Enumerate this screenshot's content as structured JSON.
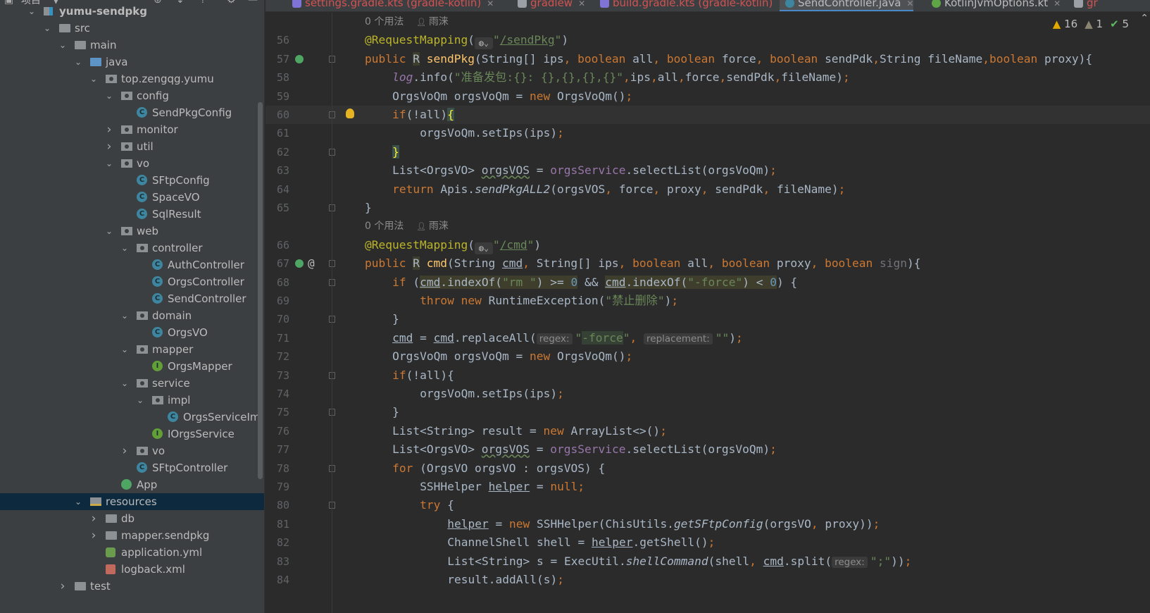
{
  "project_panel": {
    "title": "项目",
    "toolbar_icons": [
      "globe-target-icon",
      "expand-all-icon",
      "collapse-all-icon",
      "gear-icon",
      "minimize-icon"
    ],
    "tree": [
      {
        "label": "yumu-sendpkg",
        "level": 0,
        "icon": "module",
        "arrow": "open",
        "bold": true
      },
      {
        "label": "src",
        "level": 1,
        "icon": "folder",
        "arrow": "open"
      },
      {
        "label": "main",
        "level": 2,
        "icon": "folder",
        "arrow": "open"
      },
      {
        "label": "java",
        "level": 3,
        "icon": "folder-blue",
        "arrow": "open"
      },
      {
        "label": "top.zengqg.yumu",
        "level": 4,
        "icon": "package",
        "arrow": "open"
      },
      {
        "label": "config",
        "level": 5,
        "icon": "package",
        "arrow": "open"
      },
      {
        "label": "SendPkgConfig",
        "level": 6,
        "icon": "class"
      },
      {
        "label": "monitor",
        "level": 5,
        "icon": "package",
        "arrow": "closed"
      },
      {
        "label": "util",
        "level": 5,
        "icon": "package",
        "arrow": "closed"
      },
      {
        "label": "vo",
        "level": 5,
        "icon": "package",
        "arrow": "open"
      },
      {
        "label": "SFtpConfig",
        "level": 6,
        "icon": "class"
      },
      {
        "label": "SpaceVO",
        "level": 6,
        "icon": "class"
      },
      {
        "label": "SqlResult",
        "level": 6,
        "icon": "class"
      },
      {
        "label": "web",
        "level": 5,
        "icon": "package",
        "arrow": "open"
      },
      {
        "label": "controller",
        "level": 6,
        "icon": "package",
        "arrow": "open"
      },
      {
        "label": "AuthController",
        "level": 7,
        "icon": "class"
      },
      {
        "label": "OrgsController",
        "level": 7,
        "icon": "class"
      },
      {
        "label": "SendController",
        "level": 7,
        "icon": "class"
      },
      {
        "label": "domain",
        "level": 6,
        "icon": "package",
        "arrow": "open"
      },
      {
        "label": "OrgsVO",
        "level": 7,
        "icon": "class"
      },
      {
        "label": "mapper",
        "level": 6,
        "icon": "package",
        "arrow": "open"
      },
      {
        "label": "OrgsMapper",
        "level": 7,
        "icon": "interface"
      },
      {
        "label": "service",
        "level": 6,
        "icon": "package",
        "arrow": "open"
      },
      {
        "label": "impl",
        "level": 7,
        "icon": "package",
        "arrow": "open"
      },
      {
        "label": "OrgsServiceIm|",
        "level": 8,
        "icon": "class"
      },
      {
        "label": "IOrgsService",
        "level": 7,
        "icon": "interface"
      },
      {
        "label": "vo",
        "level": 6,
        "icon": "package",
        "arrow": "closed"
      },
      {
        "label": "SFtpController",
        "level": 6,
        "icon": "class"
      },
      {
        "label": "App",
        "level": 5,
        "icon": "app"
      },
      {
        "label": "resources",
        "level": 3,
        "icon": "resources",
        "arrow": "open",
        "selected": true
      },
      {
        "label": "db",
        "level": 4,
        "icon": "folder",
        "arrow": "closed"
      },
      {
        "label": "mapper.sendpkg",
        "level": 4,
        "icon": "folder",
        "arrow": "closed"
      },
      {
        "label": "application.yml",
        "level": 4,
        "icon": "yml"
      },
      {
        "label": "logback.xml",
        "level": 4,
        "icon": "xml"
      },
      {
        "label": "test",
        "level": 2,
        "icon": "folder",
        "arrow": "closed"
      }
    ]
  },
  "tabs": [
    {
      "label": "settings.gradle.kts (gradle-kotlin)",
      "icon": "gradle",
      "error": true
    },
    {
      "label": "gradlew",
      "icon": "file",
      "error": true
    },
    {
      "label": "build.gradle.kts (gradle-kotlin)",
      "icon": "gradle",
      "error": true
    },
    {
      "label": "SendController.java",
      "icon": "java",
      "active": true
    },
    {
      "label": "KotlinJvmOptions.kt",
      "icon": "kt"
    },
    {
      "label": "gr",
      "icon": "file",
      "error": true
    }
  ],
  "inspections": {
    "warnings": "16",
    "weak_warnings": "1",
    "typos": "5"
  },
  "colors": {
    "accent": "#4a88c7",
    "keyword": "#cc7832",
    "string": "#6a8759",
    "annotation": "#bbb529",
    "method": "#ffc66d",
    "number": "#6897bb",
    "field": "#9876aa",
    "text": "#a9b7c6",
    "selection": "#0d293e"
  },
  "editor": {
    "rows": [
      {
        "inlay": {
          "usages": "0 个用法",
          "author": "雨涞"
        }
      },
      {
        "ln": "56",
        "t": [
          [
            "ann",
            "@RequestMapping"
          ],
          [
            "",
            "("
          ],
          [
            "globe",
            ""
          ],
          [
            "str",
            "\""
          ],
          [
            "str link",
            "/sendPkg"
          ],
          [
            "str",
            "\""
          ],
          [
            "",
            ")"
          ]
        ]
      },
      {
        "ln": "57",
        "g": "web",
        "fold": true,
        "t": [
          [
            "kw",
            "public "
          ],
          [
            "hl",
            "R"
          ],
          [
            "",
            " "
          ],
          [
            "fn",
            "sendPkg"
          ],
          [
            "",
            "(String[] ips"
          ],
          [
            "kw",
            ", boolean "
          ],
          [
            "",
            "all"
          ],
          [
            "kw",
            ", boolean "
          ],
          [
            "",
            "force"
          ],
          [
            "kw",
            ", boolean "
          ],
          [
            "",
            "sendPdk"
          ],
          [
            "kw",
            ","
          ],
          [
            "",
            "String fileName"
          ],
          [
            "kw",
            ",boolean "
          ],
          [
            "",
            "proxy){"
          ]
        ]
      },
      {
        "ln": "58",
        "i": 1,
        "t": [
          [
            "fldi",
            "log"
          ],
          [
            "",
            ".info("
          ],
          [
            "str",
            "\"准备发包:{}: {},{},{},{}\""
          ],
          [
            "kw",
            ","
          ],
          [
            "",
            "ips"
          ],
          [
            "kw",
            ","
          ],
          [
            "",
            "all"
          ],
          [
            "kw",
            ","
          ],
          [
            "",
            "force"
          ],
          [
            "kw",
            ","
          ],
          [
            "",
            "sendPdk"
          ],
          [
            "kw",
            ","
          ],
          [
            "",
            "fileName)"
          ],
          [
            "kw",
            ";"
          ]
        ]
      },
      {
        "ln": "59",
        "i": 1,
        "t": [
          [
            "",
            "OrgsVoQm orgsVoQm = "
          ],
          [
            "kw",
            "new "
          ],
          [
            "",
            "OrgsVoQm()"
          ],
          [
            "kw",
            ";"
          ]
        ]
      },
      {
        "ln": "60",
        "i": 1,
        "cur": true,
        "fold": true,
        "bulb": true,
        "t": [
          [
            "kw",
            "if"
          ],
          [
            "",
            "(!all)"
          ],
          [
            "brace",
            "{"
          ]
        ]
      },
      {
        "ln": "61",
        "i": 2,
        "t": [
          [
            "",
            "orgsVoQm.setIps(ips)"
          ],
          [
            "kw",
            ";"
          ]
        ]
      },
      {
        "ln": "62",
        "i": 1,
        "fold": true,
        "t": [
          [
            "brace",
            "}"
          ]
        ]
      },
      {
        "ln": "63",
        "i": 1,
        "t": [
          [
            "",
            "List<OrgsVO> "
          ],
          [
            "wavy",
            "orgsVOS"
          ],
          [
            "",
            " = "
          ],
          [
            "fld",
            "orgsService"
          ],
          [
            "",
            ".selectList(orgsVoQm)"
          ],
          [
            "kw",
            ";"
          ]
        ]
      },
      {
        "ln": "64",
        "i": 1,
        "t": [
          [
            "kw",
            "return "
          ],
          [
            "",
            "Apis."
          ],
          [
            "it",
            "sendPkgALL2"
          ],
          [
            "",
            "(orgsVOS"
          ],
          [
            "kw",
            ", "
          ],
          [
            "",
            "force"
          ],
          [
            "kw",
            ", "
          ],
          [
            "",
            "proxy"
          ],
          [
            "kw",
            ", "
          ],
          [
            "",
            "sendPdk"
          ],
          [
            "kw",
            ", "
          ],
          [
            "",
            "fileName)"
          ],
          [
            "kw",
            ";"
          ]
        ]
      },
      {
        "ln": "65",
        "fold": true,
        "t": [
          [
            "",
            "}"
          ]
        ]
      },
      {
        "inlay": {
          "usages": "0 个用法",
          "author": "雨涞"
        }
      },
      {
        "ln": "66",
        "t": [
          [
            "ann",
            "@RequestMapping"
          ],
          [
            "",
            "("
          ],
          [
            "globe",
            ""
          ],
          [
            "str",
            "\""
          ],
          [
            "str link",
            "/cmd"
          ],
          [
            "str",
            "\""
          ],
          [
            "",
            ")"
          ]
        ]
      },
      {
        "ln": "67",
        "g": "web",
        "at": true,
        "fold": true,
        "t": [
          [
            "kw",
            "public "
          ],
          [
            "hl",
            "R"
          ],
          [
            "",
            " "
          ],
          [
            "fn",
            "cmd"
          ],
          [
            "",
            "(String "
          ],
          [
            "ul",
            "cmd"
          ],
          [
            "kw",
            ", "
          ],
          [
            "",
            "String[] ips"
          ],
          [
            "kw",
            ", boolean "
          ],
          [
            "",
            "all"
          ],
          [
            "kw",
            ", boolean "
          ],
          [
            "",
            "proxy"
          ],
          [
            "kw",
            ", boolean "
          ],
          [
            "unused",
            "sign"
          ],
          [
            "",
            "){"
          ]
        ]
      },
      {
        "ln": "68",
        "i": 1,
        "fold": true,
        "t": [
          [
            "kw",
            "if "
          ],
          [
            "",
            "("
          ],
          [
            "ul hl",
            "cmd"
          ],
          [
            "hl",
            ".indexOf("
          ],
          [
            "str hl",
            "\"rm \""
          ],
          [
            "hl",
            ") >= "
          ],
          [
            "num hl",
            "0"
          ],
          [
            "",
            " && "
          ],
          [
            "ul hl",
            "cmd"
          ],
          [
            "hl",
            ".indexOf("
          ],
          [
            "str hl",
            "\"-force\""
          ],
          [
            "hl",
            ") < "
          ],
          [
            "num hl",
            "0"
          ],
          [
            "",
            ") {"
          ]
        ]
      },
      {
        "ln": "69",
        "i": 2,
        "t": [
          [
            "kw",
            "throw new "
          ],
          [
            "",
            "RuntimeException("
          ],
          [
            "str",
            "\"禁止删除\""
          ],
          [
            "",
            ")"
          ],
          [
            "kw",
            ";"
          ]
        ]
      },
      {
        "ln": "70",
        "i": 1,
        "fold": true,
        "t": [
          [
            "",
            "}"
          ]
        ]
      },
      {
        "ln": "71",
        "i": 1,
        "t": [
          [
            "ul",
            "cmd"
          ],
          [
            "",
            " = "
          ],
          [
            "ul",
            "cmd"
          ],
          [
            "",
            ".replaceAll("
          ],
          [
            "hint",
            "regex:"
          ],
          [
            "str",
            "\""
          ],
          [
            "str hlg",
            "-force"
          ],
          [
            "str",
            "\""
          ],
          [
            "kw",
            ", "
          ],
          [
            "hint",
            "replacement:"
          ],
          [
            "str",
            "\"\""
          ],
          [
            "",
            ")"
          ],
          [
            "kw",
            ";"
          ]
        ]
      },
      {
        "ln": "72",
        "i": 1,
        "t": [
          [
            "",
            "OrgsVoQm orgsVoQm = "
          ],
          [
            "kw",
            "new "
          ],
          [
            "",
            "OrgsVoQm()"
          ],
          [
            "kw",
            ";"
          ]
        ]
      },
      {
        "ln": "73",
        "i": 1,
        "fold": true,
        "t": [
          [
            "kw",
            "if"
          ],
          [
            "",
            "(!all){"
          ]
        ]
      },
      {
        "ln": "74",
        "i": 2,
        "t": [
          [
            "",
            "orgsVoQm.setIps(ips)"
          ],
          [
            "kw",
            ";"
          ]
        ]
      },
      {
        "ln": "75",
        "i": 1,
        "fold": true,
        "t": [
          [
            "",
            "}"
          ]
        ]
      },
      {
        "ln": "76",
        "i": 1,
        "t": [
          [
            "",
            "List<String> result = "
          ],
          [
            "kw",
            "new "
          ],
          [
            "",
            "ArrayList<>()"
          ],
          [
            "kw",
            ";"
          ]
        ]
      },
      {
        "ln": "77",
        "i": 1,
        "t": [
          [
            "",
            "List<OrgsVO> "
          ],
          [
            "wavy",
            "orgsVOS"
          ],
          [
            "",
            " = "
          ],
          [
            "fld",
            "orgsService"
          ],
          [
            "",
            ".selectList(orgsVoQm)"
          ],
          [
            "kw",
            ";"
          ]
        ]
      },
      {
        "ln": "78",
        "i": 1,
        "fold": true,
        "t": [
          [
            "kw",
            "for "
          ],
          [
            "",
            "(OrgsVO orgsVO : orgsVOS) {"
          ]
        ]
      },
      {
        "ln": "79",
        "i": 2,
        "t": [
          [
            "",
            "SSHHelper "
          ],
          [
            "ul",
            "helper"
          ],
          [
            "",
            " = "
          ],
          [
            "kw",
            "null;"
          ]
        ]
      },
      {
        "ln": "80",
        "i": 2,
        "fold": true,
        "t": [
          [
            "kw",
            "try "
          ],
          [
            "",
            "{"
          ]
        ]
      },
      {
        "ln": "81",
        "i": 3,
        "t": [
          [
            "ul",
            "helper"
          ],
          [
            "",
            " = "
          ],
          [
            "kw",
            "new "
          ],
          [
            "",
            "SSHHelper(ChisUtils."
          ],
          [
            "it",
            "getSFtpConfig"
          ],
          [
            "",
            "(orgsVO"
          ],
          [
            "kw",
            ", "
          ],
          [
            "",
            "proxy))"
          ],
          [
            "kw",
            ";"
          ]
        ]
      },
      {
        "ln": "82",
        "i": 3,
        "t": [
          [
            "",
            "ChannelShell shell = "
          ],
          [
            "ul",
            "helper"
          ],
          [
            "",
            ".getShell()"
          ],
          [
            "kw",
            ";"
          ]
        ]
      },
      {
        "ln": "83",
        "i": 3,
        "t": [
          [
            "",
            "List<String> s = ExecUtil."
          ],
          [
            "it",
            "shellCommand"
          ],
          [
            "",
            "(shell"
          ],
          [
            "kw",
            ", "
          ],
          [
            "ul",
            "cmd"
          ],
          [
            "",
            ".split("
          ],
          [
            "hint",
            "regex:"
          ],
          [
            "str",
            "\";\""
          ],
          [
            "",
            "))"
          ],
          [
            "kw",
            ";"
          ]
        ]
      },
      {
        "ln": "84",
        "i": 3,
        "t": [
          [
            "",
            "result.addAll(s)"
          ],
          [
            "kw",
            ";"
          ]
        ]
      }
    ]
  }
}
